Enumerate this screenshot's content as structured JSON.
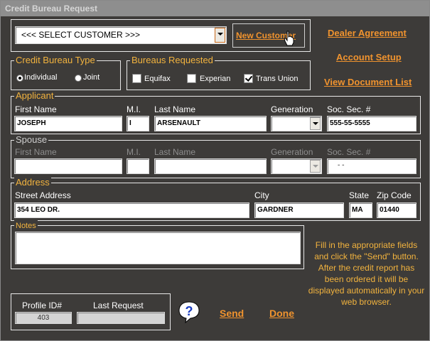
{
  "window": {
    "title": "Credit Bureau Request"
  },
  "customer": {
    "select_value": "<<< SELECT CUSTOMER >>>",
    "new_customer": "New Customer"
  },
  "links": {
    "dealer_agreement": "Dealer Agreement",
    "account_setup": "Account Setup",
    "view_document_list": "View Document List"
  },
  "credit_type": {
    "legend": "Credit Bureau Type",
    "individual": "Individual",
    "joint": "Joint",
    "selected": "individual"
  },
  "bureaus": {
    "legend": "Bureaus Requested",
    "equifax": "Equifax",
    "experian": "Experian",
    "trans_union": "Trans Union",
    "checked": [
      "trans_union"
    ]
  },
  "applicant": {
    "legend": "Applicant",
    "labels": {
      "first_name": "First Name",
      "mi": "M.I.",
      "last_name": "Last Name",
      "generation": "Generation",
      "ssn": "Soc. Sec. #"
    },
    "values": {
      "first_name": "JOSEPH",
      "mi": "I",
      "last_name": "ARSENAULT",
      "generation": "",
      "ssn": "555-55-5555"
    }
  },
  "spouse": {
    "legend": "Spouse",
    "labels": {
      "first_name": "First Name",
      "mi": "M.I.",
      "last_name": "Last Name",
      "generation": "Generation",
      "ssn": "Soc. Sec. #"
    },
    "values": {
      "first_name": "",
      "mi": "",
      "last_name": "",
      "generation": "",
      "ssn": "-  -"
    }
  },
  "address": {
    "legend": "Address",
    "labels": {
      "street": "Street Address",
      "city": "City",
      "state": "State",
      "zip": "Zip Code"
    },
    "values": {
      "street": "354 LEO DR.",
      "city": "GARDNER",
      "state": "MA",
      "zip": "01440"
    }
  },
  "notes": {
    "legend": "Notes",
    "value": ""
  },
  "help_text": "Fill in the appropriate fields and click the \"Send\" button.  After the credit report has been ordered it will be displayed automatically in your web browser.",
  "profile": {
    "id_label": "Profile ID#",
    "id_value": "403",
    "last_request_label": "Last Request",
    "last_request_value": ""
  },
  "actions": {
    "send": "Send",
    "done": "Done"
  },
  "colors": {
    "accent": "#f0932e",
    "legend": "#f2b33e",
    "background": "#3d3b39"
  }
}
